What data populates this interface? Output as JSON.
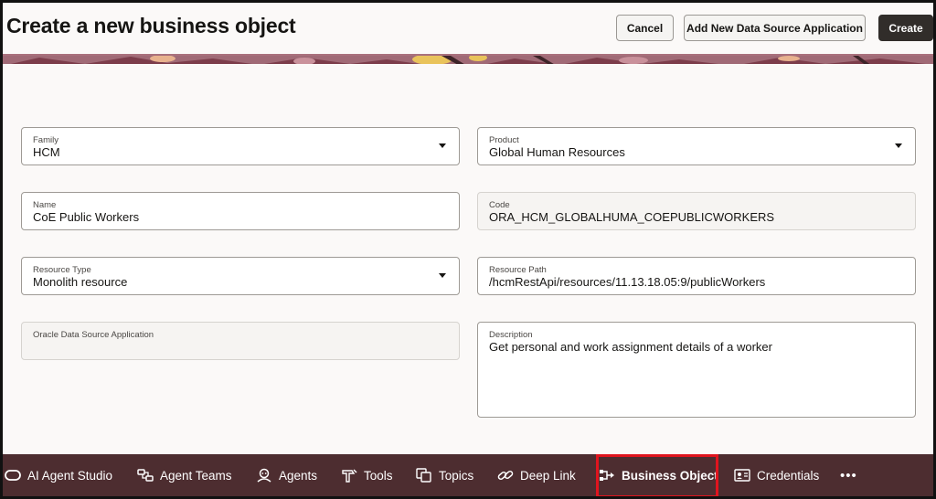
{
  "header": {
    "title": "Create a new business object",
    "cancel_label": "Cancel",
    "add_source_label": "Add New Data Source Application",
    "create_label": "Create"
  },
  "form": {
    "family": {
      "label": "Family",
      "value": "HCM"
    },
    "product": {
      "label": "Product",
      "value": "Global Human Resources"
    },
    "name": {
      "label": "Name",
      "value": "CoE Public Workers"
    },
    "code": {
      "label": "Code",
      "value": "ORA_HCM_GLOBALHUMA_COEPUBLICWORKERS"
    },
    "resource_type": {
      "label": "Resource Type",
      "value": "Monolith resource"
    },
    "resource_path": {
      "label": "Resource Path",
      "value": "/hcmRestApi/resources/11.13.18.05:9/publicWorkers"
    },
    "oracle_source": {
      "label": "Oracle Data Source Application",
      "value": ""
    },
    "description": {
      "label": "Description",
      "value": "Get personal and work assignment details of a worker"
    }
  },
  "nav": {
    "items": [
      {
        "label": "AI Agent Studio",
        "icon": "studio-icon"
      },
      {
        "label": "Agent Teams",
        "icon": "agent-teams-icon"
      },
      {
        "label": "Agents",
        "icon": "agents-icon"
      },
      {
        "label": "Tools",
        "icon": "tools-icon"
      },
      {
        "label": "Topics",
        "icon": "topics-icon"
      },
      {
        "label": "Deep Link",
        "icon": "link-icon"
      },
      {
        "label": "Business Object",
        "icon": "business-object-icon",
        "active": true
      },
      {
        "label": "Credentials",
        "icon": "credentials-icon"
      },
      {
        "label": "•••",
        "icon": "more-icon"
      }
    ]
  },
  "colors": {
    "nav_background": "#4d2d30",
    "primary_button": "#312d2a",
    "highlight": "#e0141e",
    "page_background": "#fbf9f8"
  }
}
